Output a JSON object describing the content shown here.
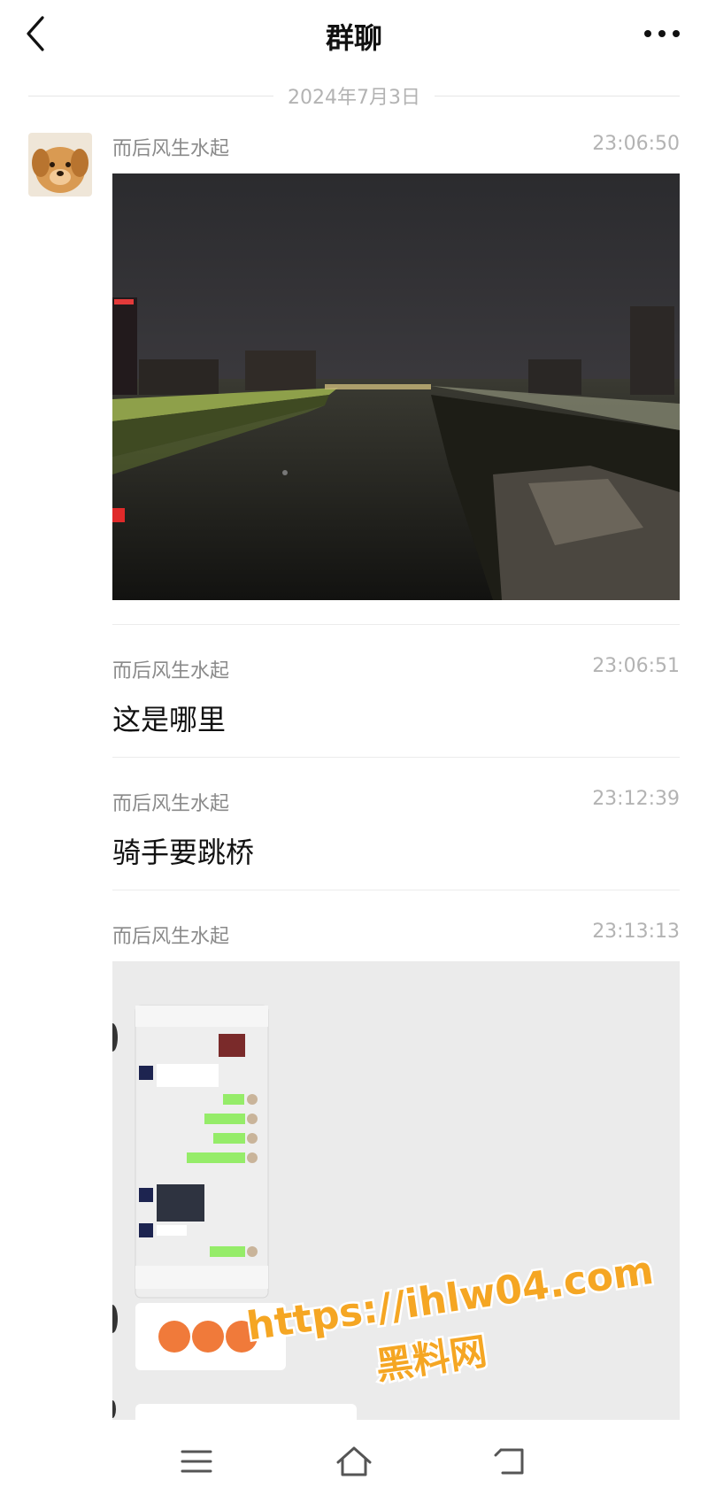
{
  "header": {
    "title": "群聊"
  },
  "date_separator": "2024年7月3日",
  "messages": [
    {
      "sender": "而后风生水起",
      "time": "23:06:50",
      "kind": "image"
    },
    {
      "sender": "而后风生水起",
      "time": "23:06:51",
      "kind": "text",
      "text": "这是哪里"
    },
    {
      "sender": "而后风生水起",
      "time": "23:12:39",
      "kind": "text",
      "text": "骑手要跳桥"
    },
    {
      "sender": "而后风生水起",
      "time": "23:13:13",
      "kind": "image"
    }
  ],
  "watermark": {
    "url": "https://ihlw04.com",
    "name": "黑料网"
  },
  "icons": [
    "chevron-left-icon",
    "more-dots-icon",
    "menu-icon",
    "home-icon",
    "back-icon"
  ],
  "colors": {
    "green_bubble": "#95ec69",
    "watermark_fill": "#f5a623",
    "muted": "#8a8a8a"
  }
}
